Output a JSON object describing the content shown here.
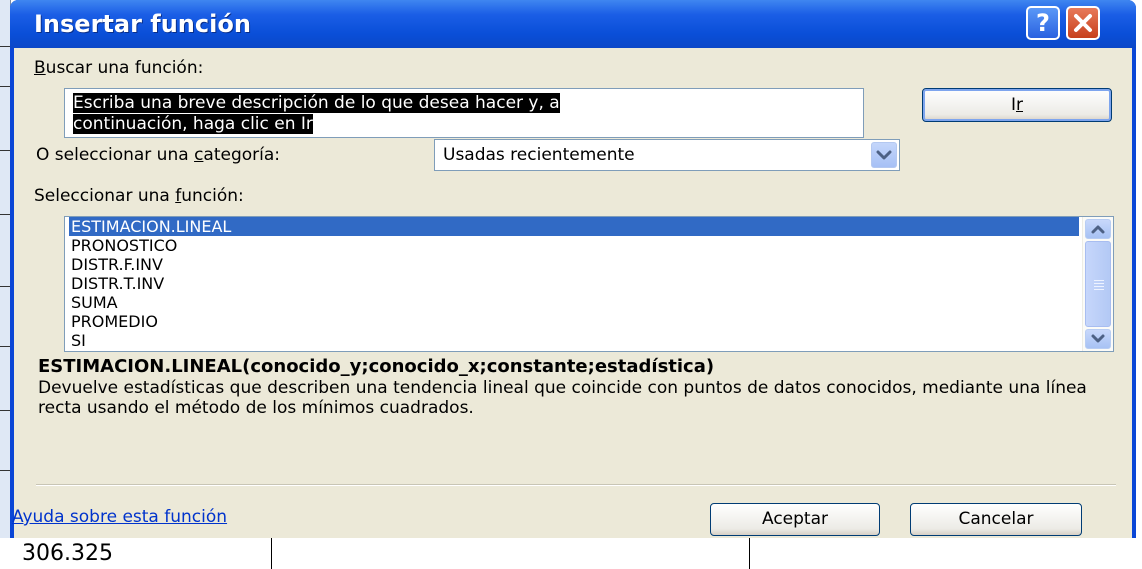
{
  "dialog": {
    "title": "Insertar función",
    "help_button": "?",
    "close_button": "✕"
  },
  "search": {
    "label_prefix": "",
    "label_accesskey": "B",
    "label_rest": "uscar una función:",
    "value_line1": "Escriba una breve descripción de lo que desea hacer y, a",
    "value_line2": "continuación, haga clic en Ir",
    "go_button_prefix": "I",
    "go_button_accesskey": "r"
  },
  "category": {
    "label_prefix": "O seleccionar una ",
    "label_accesskey": "c",
    "label_rest": "ategoría:",
    "selected": "Usadas recientemente"
  },
  "functions": {
    "label_prefix": "Seleccionar una ",
    "label_accesskey": "f",
    "label_rest": "unción:",
    "items": [
      "ESTIMACION.LINEAL",
      "PRONOSTICO",
      "DISTR.F.INV",
      "DISTR.T.INV",
      "SUMA",
      "PROMEDIO",
      "SI"
    ],
    "selected_index": 0
  },
  "details": {
    "signature": "ESTIMACION.LINEAL(conocido_y;conocido_x;constante;estadística)",
    "description": "Devuelve estadísticas que describen una tendencia lineal que coincide con puntos de datos conocidos, mediante una línea recta usando el método de los mínimos cuadrados."
  },
  "footer": {
    "help_link": "Ayuda sobre esta función",
    "ok_button": "Aceptar",
    "cancel_button": "Cancelar"
  },
  "sheet": {
    "cell_value": "306.325"
  },
  "colors": {
    "titlebar": "#0a4fd8",
    "dialog_face": "#ece9d8",
    "selection": "#316ac5",
    "link": "#0033cc"
  }
}
